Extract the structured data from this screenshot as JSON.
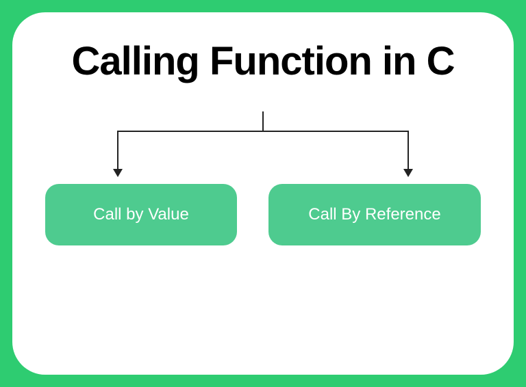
{
  "title": "Calling Function in C",
  "nodes": {
    "left": "Call by Value",
    "right": "Call By Reference"
  },
  "colors": {
    "background": "#2ecc71",
    "pill": "#4ecb8f",
    "text_title": "#000000",
    "text_pill": "#ffffff",
    "connector": "#222222"
  }
}
